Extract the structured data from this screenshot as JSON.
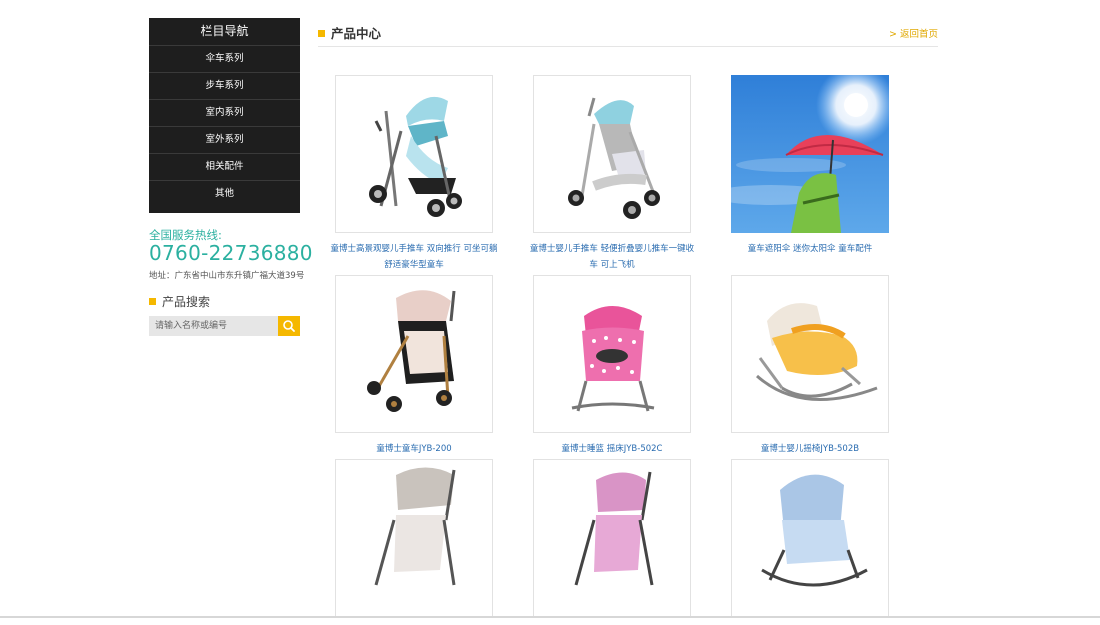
{
  "sidebar": {
    "nav_title": "栏目导航",
    "nav_items": [
      {
        "label": "伞车系列"
      },
      {
        "label": "步车系列"
      },
      {
        "label": "室内系列"
      },
      {
        "label": "室外系列"
      },
      {
        "label": "相关配件"
      },
      {
        "label": "其他"
      }
    ],
    "hotline_label": "全国服务热线:",
    "hotline_number": "0760-22736880",
    "address": "地址：广东省中山市东升镇广福大道39号",
    "search_title": "产品搜索",
    "search_placeholder": "请输入名称或编号",
    "search_icon": "search-icon"
  },
  "main": {
    "title": "产品中心",
    "home_link": "> 返回首页",
    "products": [
      {
        "caption": "童博士高景观婴儿手推车 双向推行 可坐可躺舒适豪华型童车",
        "icon": "stroller-icon"
      },
      {
        "caption": "童博士婴儿手推车 轻便折叠婴儿推车一键收车 可上飞机",
        "icon": "stroller-icon"
      },
      {
        "caption": "童车遮阳伞 迷你太阳伞 童车配件",
        "icon": "parasol-icon"
      },
      {
        "caption": "童博士童车JYB-200",
        "icon": "stroller-icon"
      },
      {
        "caption": "童博士睡篮 摇床JYB-502C",
        "icon": "cradle-icon"
      },
      {
        "caption": "童博士婴儿摇椅JYB-502B",
        "icon": "rocker-icon"
      },
      {
        "caption": "",
        "icon": "stroller-icon"
      },
      {
        "caption": "",
        "icon": "stroller-icon"
      },
      {
        "caption": "",
        "icon": "rocker-icon"
      }
    ]
  },
  "colors": {
    "accent": "#f5b800",
    "hotline": "#2bb0a0",
    "caption_link": "#2a6cb0",
    "nav_bg": "#1e1e1e"
  }
}
